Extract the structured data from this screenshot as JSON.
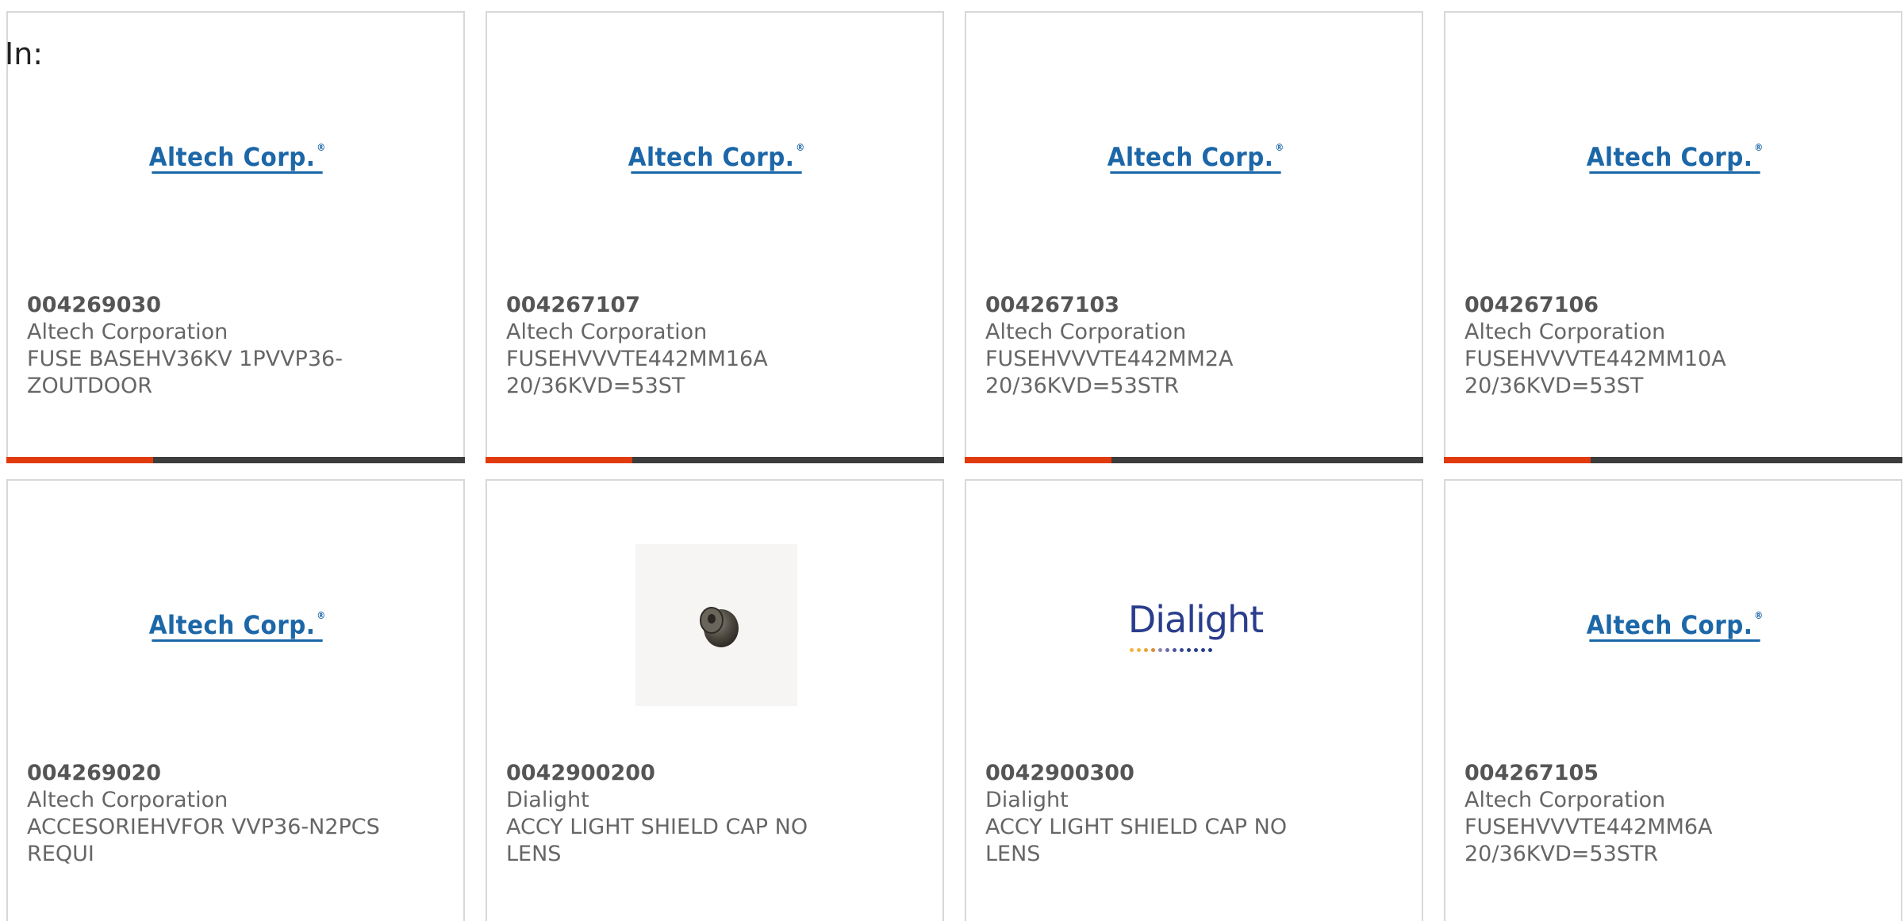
{
  "header": {
    "in_label": "In:"
  },
  "colors": {
    "progress_fill": "#e13a0c",
    "progress_track": "#3d3d3d",
    "altech_blue": "#1c67a8",
    "dialight_blue": "#2a3d8c"
  },
  "products": [
    {
      "part_number": "004269030",
      "manufacturer": "Altech Corporation",
      "description_line1": "FUSE BASEHV36KV 1PVVP36-",
      "description_line2": "ZOUTDOOR",
      "image": "altech-logo",
      "progress": 0.32
    },
    {
      "part_number": "004267107",
      "manufacturer": "Altech Corporation",
      "description_line1": "FUSEHVVVTE442MM16A",
      "description_line2": "20/36KVD=53ST",
      "image": "altech-logo",
      "progress": 0.32
    },
    {
      "part_number": "004267103",
      "manufacturer": "Altech Corporation",
      "description_line1": "FUSEHVVVTE442MM2A",
      "description_line2": "20/36KVD=53STR",
      "image": "altech-logo",
      "progress": 0.32
    },
    {
      "part_number": "004267106",
      "manufacturer": "Altech Corporation",
      "description_line1": "FUSEHVVVTE442MM10A",
      "description_line2": "20/36KVD=53ST",
      "image": "altech-logo",
      "progress": 0.32
    },
    {
      "part_number": "004269020",
      "manufacturer": "Altech Corporation",
      "description_line1": "ACCESORIEHVFOR VVP36-N2PCS",
      "description_line2": "REQUI",
      "image": "altech-logo"
    },
    {
      "part_number": "0042900200",
      "manufacturer": "Dialight",
      "description_line1": "ACCY LIGHT SHIELD CAP NO",
      "description_line2": "LENS",
      "image": "shield-cap-photo"
    },
    {
      "part_number": "0042900300",
      "manufacturer": "Dialight",
      "description_line1": "ACCY LIGHT SHIELD CAP NO",
      "description_line2": "LENS",
      "image": "dialight-logo"
    },
    {
      "part_number": "004267105",
      "manufacturer": "Altech Corporation",
      "description_line1": "FUSEHVVVTE442MM6A",
      "description_line2": "20/36KVD=53STR",
      "image": "altech-logo"
    }
  ],
  "logos": {
    "altech": {
      "text": "Altech Corp.",
      "mark": "®"
    },
    "dialight": {
      "text": "Dialight"
    }
  }
}
